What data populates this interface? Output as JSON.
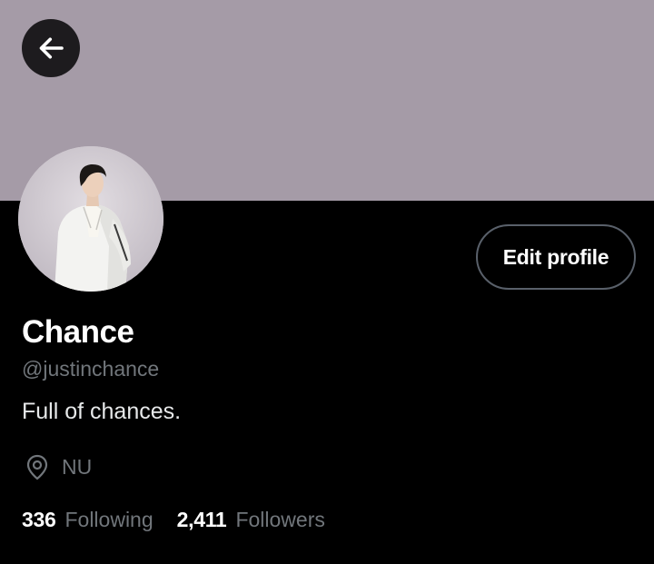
{
  "profile": {
    "banner_color": "#a59ba7",
    "display_name": "Chance",
    "handle": "@justinchance",
    "bio": "Full of chances.",
    "location": "NU",
    "edit_profile_label": "Edit profile",
    "avatar_icon": "profile-photo"
  },
  "stats": {
    "following_count": "336",
    "following_label": "Following",
    "followers_count": "2,411",
    "followers_label": "Followers"
  },
  "nav": {
    "back_icon": "arrow-left-icon"
  },
  "colors": {
    "background": "#000000",
    "primary_text": "#ffffff",
    "secondary_text": "#71767b",
    "button_border": "#59606a"
  }
}
